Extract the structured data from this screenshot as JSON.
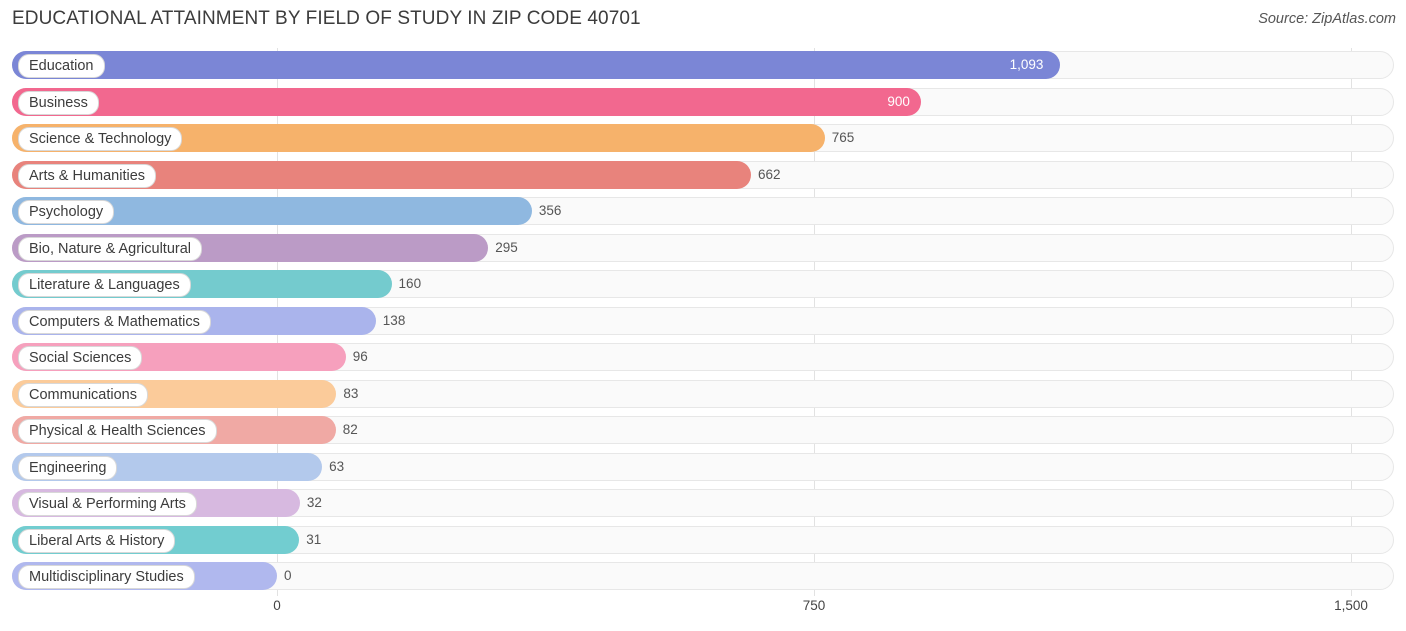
{
  "header": {
    "title": "EDUCATIONAL ATTAINMENT BY FIELD OF STUDY IN ZIP CODE 40701",
    "source": "Source: ZipAtlas.com"
  },
  "chart_data": {
    "type": "bar",
    "orientation": "horizontal",
    "title": "EDUCATIONAL ATTAINMENT BY FIELD OF STUDY IN ZIP CODE 40701",
    "xlabel": "",
    "ylabel": "",
    "xlim": [
      0,
      1500
    ],
    "ticks": [
      "0",
      "750",
      "1,500"
    ],
    "tick_values": [
      0,
      750,
      1500
    ],
    "grid": true,
    "legend": false,
    "categories": [
      "Education",
      "Business",
      "Science & Technology",
      "Arts & Humanities",
      "Psychology",
      "Bio, Nature & Agricultural",
      "Literature & Languages",
      "Computers & Mathematics",
      "Social Sciences",
      "Communications",
      "Physical & Health Sciences",
      "Engineering",
      "Visual & Performing Arts",
      "Liberal Arts & History",
      "Multidisciplinary Studies"
    ],
    "values": [
      1093,
      900,
      765,
      662,
      356,
      295,
      160,
      138,
      96,
      83,
      82,
      63,
      32,
      31,
      0
    ],
    "value_labels": [
      "1,093",
      "900",
      "765",
      "662",
      "356",
      "295",
      "160",
      "138",
      "96",
      "83",
      "82",
      "63",
      "32",
      "31",
      "0"
    ],
    "colors": [
      "#7b86d6",
      "#f2688f",
      "#f6b26b",
      "#e8837c",
      "#8fb8e0",
      "#bb9bc6",
      "#74cbce",
      "#aab4ec",
      "#f6a0bd",
      "#fbcb9a",
      "#f0a9a4",
      "#b3c9ec",
      "#d7b9e0",
      "#72cdd0",
      "#b0b8ee"
    ]
  }
}
